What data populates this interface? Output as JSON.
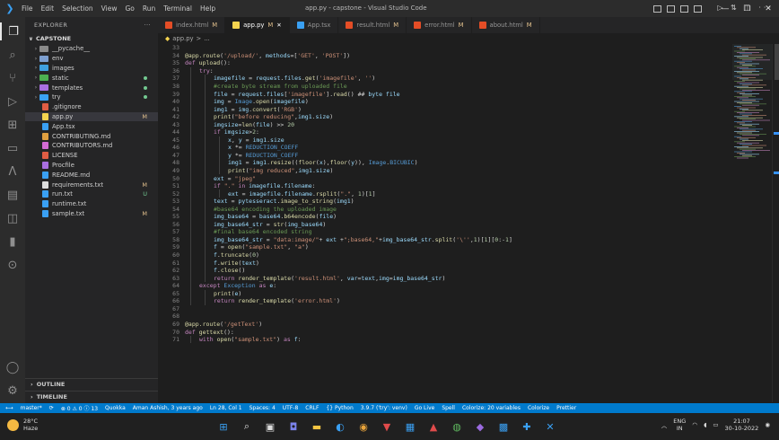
{
  "window": {
    "title": "app.py - capstone - Visual Studio Code",
    "menu": [
      "File",
      "Edit",
      "Selection",
      "View",
      "Go",
      "Run",
      "Terminal",
      "Help"
    ]
  },
  "explorer": {
    "header": "EXPLORER",
    "root": "CAPSTONE",
    "items": [
      {
        "label": "__pycache__",
        "type": "folder",
        "color": "#8a8a8a",
        "badge": ""
      },
      {
        "label": "env",
        "type": "folder",
        "color": "#7d9fd0",
        "badge": ""
      },
      {
        "label": "images",
        "type": "folder",
        "color": "#3fa0e0",
        "badge": ""
      },
      {
        "label": "static",
        "type": "folder",
        "color": "#4caf50",
        "badge": "dot"
      },
      {
        "label": "templates",
        "type": "folder",
        "color": "#a96fe0",
        "badge": "dot"
      },
      {
        "label": "try",
        "type": "folder",
        "color": "#3aa0f3",
        "badge": "dot"
      },
      {
        "label": ".gitignore",
        "type": "file",
        "color": "#e05d44",
        "badge": ""
      },
      {
        "label": "app.py",
        "type": "file",
        "color": "#f5d44f",
        "badge": "M",
        "selected": true
      },
      {
        "label": "App.tsx",
        "type": "file",
        "color": "#3aa0f3",
        "badge": ""
      },
      {
        "label": "CONTRIBUTING.md",
        "type": "file",
        "color": "#e0a040",
        "badge": ""
      },
      {
        "label": "CONTRIBUTORS.md",
        "type": "file",
        "color": "#d46bd4",
        "badge": ""
      },
      {
        "label": "LICENSE",
        "type": "file",
        "color": "#e05d44",
        "badge": ""
      },
      {
        "label": "Procfile",
        "type": "file",
        "color": "#a96fe0",
        "badge": ""
      },
      {
        "label": "README.md",
        "type": "file",
        "color": "#3aa0f3",
        "badge": ""
      },
      {
        "label": "requirements.txt",
        "type": "file",
        "color": "#dddddd",
        "badge": "M"
      },
      {
        "label": "run.txt",
        "type": "file",
        "color": "#3aa0f3",
        "badge": "U"
      },
      {
        "label": "runtime.txt",
        "type": "file",
        "color": "#3aa0f3",
        "badge": ""
      },
      {
        "label": "sample.txt",
        "type": "file",
        "color": "#3aa0f3",
        "badge": "M"
      }
    ],
    "outline": "OUTLINE",
    "timeline": "TIMELINE"
  },
  "tabs": [
    {
      "label": "index.html",
      "mark": "M",
      "color": "#e44d26",
      "active": false
    },
    {
      "label": "app.py",
      "mark": "M",
      "color": "#f5d44f",
      "active": true
    },
    {
      "label": "App.tsx",
      "mark": "",
      "color": "#3aa0f3",
      "active": false
    },
    {
      "label": "result.html",
      "mark": "M",
      "color": "#e44d26",
      "active": false
    },
    {
      "label": "error.html",
      "mark": "M",
      "color": "#e44d26",
      "active": false
    },
    {
      "label": "about.html",
      "mark": "M",
      "color": "#e44d26",
      "active": false
    }
  ],
  "breadcrumb": [
    "app.py",
    ">",
    "..."
  ],
  "code": [
    {
      "n": "33",
      "indent": 0,
      "text": ""
    },
    {
      "n": "34",
      "indent": 0,
      "text": "@app.route('/upload/', methods=['GET', 'POST'])"
    },
    {
      "n": "35",
      "indent": 0,
      "text": "def upload():"
    },
    {
      "n": "36",
      "indent": 1,
      "text": "try:"
    },
    {
      "n": "37",
      "indent": 2,
      "text": "imagefile = request.files.get('imagefile', '')"
    },
    {
      "n": "38",
      "indent": 2,
      "text": "#create byte stream from uploaded file"
    },
    {
      "n": "39",
      "indent": 2,
      "text": "file = request.files['imagefile'].read() ## byte file"
    },
    {
      "n": "40",
      "indent": 2,
      "text": "img = Image.open(imagefile)"
    },
    {
      "n": "41",
      "indent": 2,
      "text": "img1 = img.convert('RGB')"
    },
    {
      "n": "42",
      "indent": 2,
      "text": "print(\"before reducing\",img1.size)"
    },
    {
      "n": "43",
      "indent": 2,
      "text": "imgsize=len(file) >> 20"
    },
    {
      "n": "44",
      "indent": 2,
      "text": "if imgsize>2:"
    },
    {
      "n": "45",
      "indent": 3,
      "text": "x, y = img1.size"
    },
    {
      "n": "46",
      "indent": 3,
      "text": "x *= REDUCTION_COEFF"
    },
    {
      "n": "47",
      "indent": 3,
      "text": "y *= REDUCTION_COEFF"
    },
    {
      "n": "48",
      "indent": 3,
      "text": "img1 = img1.resize((floor(x),floor(y)), Image.BICUBIC)"
    },
    {
      "n": "49",
      "indent": 3,
      "text": "print(\"img reduced\",img1.size)"
    },
    {
      "n": "50",
      "indent": 2,
      "text": "ext = \"jpeg\""
    },
    {
      "n": "51",
      "indent": 2,
      "text": "if \".\" in imagefile.filename:"
    },
    {
      "n": "52",
      "indent": 3,
      "text": "ext = imagefile.filename.rsplit(\".\", 1)[1]"
    },
    {
      "n": "53",
      "indent": 2,
      "text": "text = pytesseract.image_to_string(img1)"
    },
    {
      "n": "54",
      "indent": 2,
      "text": "#base64 encoding the uploaded image"
    },
    {
      "n": "55",
      "indent": 2,
      "text": "img_base64 = base64.b64encode(file)"
    },
    {
      "n": "56",
      "indent": 2,
      "text": "img_base64_str = str(img_base64)"
    },
    {
      "n": "57",
      "indent": 2,
      "text": "#final base64 encoded string"
    },
    {
      "n": "58",
      "indent": 2,
      "text": "img_base64_str = \"data:image/\"+ ext +\";base64,\"+img_base64_str.split('\\'',1)[1][0:-1]"
    },
    {
      "n": "59",
      "indent": 2,
      "text": "f = open(\"sample.txt\", \"a\")"
    },
    {
      "n": "60",
      "indent": 2,
      "text": "f.truncate(0)"
    },
    {
      "n": "61",
      "indent": 2,
      "text": "f.write(text)"
    },
    {
      "n": "62",
      "indent": 2,
      "text": "f.close()"
    },
    {
      "n": "63",
      "indent": 2,
      "text": "return render_template('result.html', var=text,img=img_base64_str)"
    },
    {
      "n": "64",
      "indent": 1,
      "text": "except Exception as e:"
    },
    {
      "n": "65",
      "indent": 2,
      "text": "print(e)"
    },
    {
      "n": "66",
      "indent": 2,
      "text": "return render_template('error.html')"
    },
    {
      "n": "67",
      "indent": 0,
      "text": ""
    },
    {
      "n": "68",
      "indent": 0,
      "text": ""
    },
    {
      "n": "69",
      "indent": 0,
      "text": "@app.route('/getText')"
    },
    {
      "n": "70",
      "indent": 0,
      "text": "def gettext():"
    },
    {
      "n": "71",
      "indent": 1,
      "text": "with open(\"sample.txt\") as f:"
    }
  ],
  "statusbar": {
    "items": [
      "master*",
      "⟳",
      "⊗ 0 ⚠ 0 ⓘ 13",
      "Quokka",
      "Aman Ashish, 3 years ago",
      "Ln 28, Col 1",
      "Spaces: 4",
      "UTF-8",
      "CRLF",
      "{} Python",
      "3.9.7 ('try': venv)",
      "Go Live",
      "Spell",
      "Colorize: 20 variables",
      "Colorize",
      "Prettier"
    ]
  },
  "taskbar": {
    "weather_temp": "28°C",
    "weather_desc": "Haze",
    "lang": "ENG",
    "lang2": "IN",
    "time": "21:07",
    "date": "30-10-2022"
  }
}
